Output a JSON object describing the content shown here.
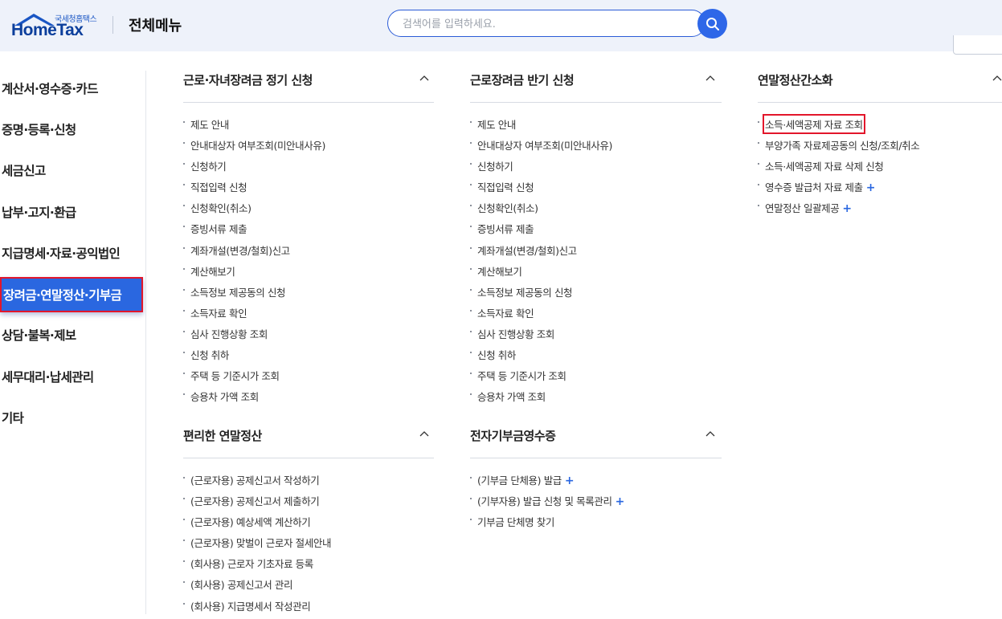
{
  "header": {
    "logo_small": "국세청홈택스",
    "logo_main": "HomeTax",
    "title": "전체메뉴",
    "search_placeholder": "검색어를 입력하세요."
  },
  "sidebar": {
    "items": [
      {
        "label": "계산서·영수증·카드"
      },
      {
        "label": "증명·등록·신청"
      },
      {
        "label": "세금신고"
      },
      {
        "label": "납부·고지·환급"
      },
      {
        "label": "지급명세·자료·공익법인"
      },
      {
        "label": "장려금·연말정산·기부금",
        "active": true
      },
      {
        "label": "상담·불복·제보"
      },
      {
        "label": "세무대리·납세관리"
      },
      {
        "label": "기타"
      }
    ]
  },
  "sections": {
    "s1": {
      "title": "근로·자녀장려금 정기 신청",
      "items": [
        "제도 안내",
        "안내대상자 여부조회(미안내사유)",
        "신청하기",
        "직접입력 신청",
        "신청확인(취소)",
        "증빙서류 제출",
        "계좌개설(변경/철회)신고",
        "계산해보기",
        "소득정보 제공동의 신청",
        "소득자료 확인",
        "심사 진행상황 조회",
        "신청 취하",
        "주택 등 기준시가 조회",
        "승용차 가액 조회"
      ]
    },
    "s2": {
      "title": "근로장려금 반기 신청",
      "items": [
        "제도 안내",
        "안내대상자 여부조회(미안내사유)",
        "신청하기",
        "직접입력 신청",
        "신청확인(취소)",
        "증빙서류 제출",
        "계좌개설(변경/철회)신고",
        "계산해보기",
        "소득정보 제공동의 신청",
        "소득자료 확인",
        "심사 진행상황 조회",
        "신청 취하",
        "주택 등 기준시가 조회",
        "승용차 가액 조회"
      ]
    },
    "s3": {
      "title": "연말정산간소화",
      "items": [
        "소득·세액공제 자료 조회",
        "부양가족 자료제공동의 신청/조회/취소",
        "소득·세액공제 자료 삭제 신청",
        "영수증 발급처 자료 제출",
        "연말정산 일괄제공"
      ]
    },
    "s4": {
      "title": "편리한 연말정산",
      "items": [
        "(근로자용) 공제신고서 작성하기",
        "(근로자용) 공제신고서 제출하기",
        "(근로자용) 예상세액 계산하기",
        "(근로자용) 맞벌이 근로자 절세안내",
        "(회사용) 근로자 기초자료 등록",
        "(회사용) 공제신고서 관리",
        "(회사용) 지급명세서 작성관리"
      ]
    },
    "s5": {
      "title": "전자기부금영수증",
      "items": [
        "(기부금 단체용) 발급",
        "(기부자용) 발급 신청 및 목록관리",
        "기부금 단체명 찾기"
      ]
    }
  },
  "colors": {
    "accent": "#2a67e0",
    "highlight_border": "#e2162b",
    "header_bg": "#eef2fa"
  }
}
